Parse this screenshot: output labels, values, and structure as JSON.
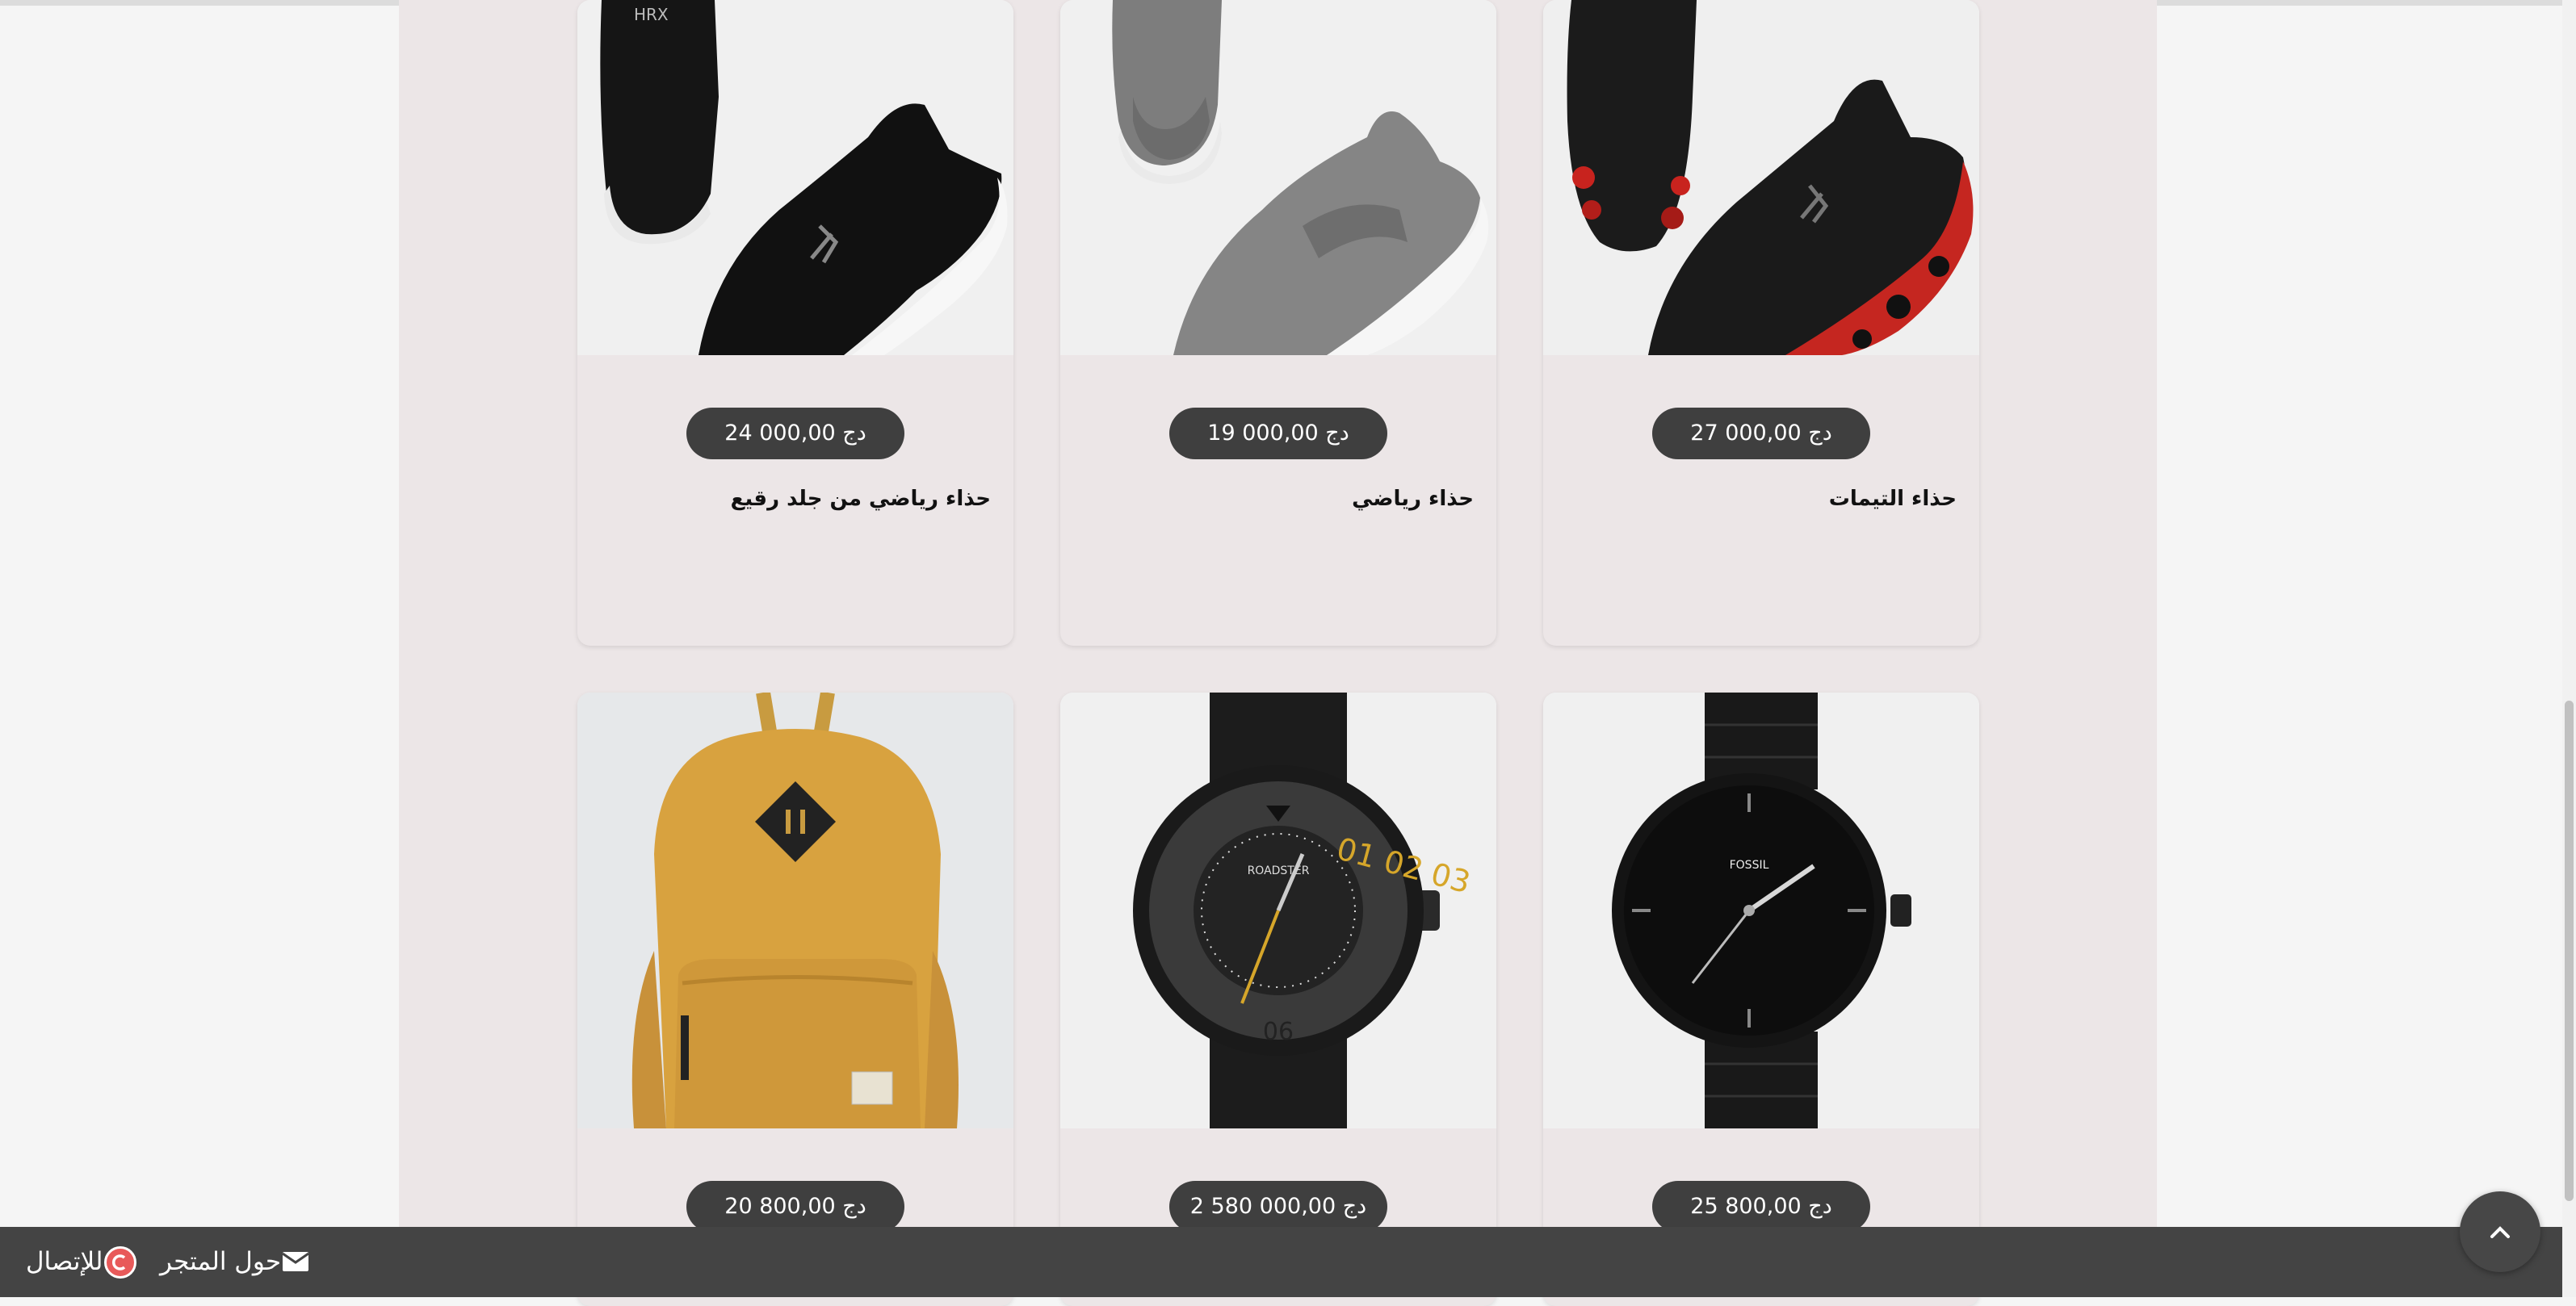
{
  "products": [
    {
      "name": "حذاء رياضي من جلد رقيع",
      "price": "24 000,00 دج",
      "image": "black-sneakers"
    },
    {
      "name": "حذاء رياضي",
      "price": "19 000,00 دج",
      "image": "grey-slip-on-sneakers"
    },
    {
      "name": "حذاء التيمات",
      "price": "27 000,00 دج",
      "image": "black-red-camo-sneakers"
    },
    {
      "name": "",
      "price": "20 800,00 دج",
      "image": "yellow-backpack"
    },
    {
      "name": "",
      "price": "2 580 000,00 دج",
      "image": "roadster-watch"
    },
    {
      "name": "",
      "price": "25 800,00 دج",
      "image": "fossil-black-watch"
    }
  ],
  "watch_text": {
    "roadster_brand": "ROADSTER",
    "fossil_brand": "FOSSIL"
  },
  "footer": {
    "contact_label": "للإتصال",
    "about_label": "حول المتجر",
    "contact_icon": "copyright-circle-icon",
    "about_icon": "envelope-icon"
  },
  "colors": {
    "footer_bg": "#444444",
    "price_badge": "#3f3f3f",
    "panel": "#ece6e7"
  }
}
